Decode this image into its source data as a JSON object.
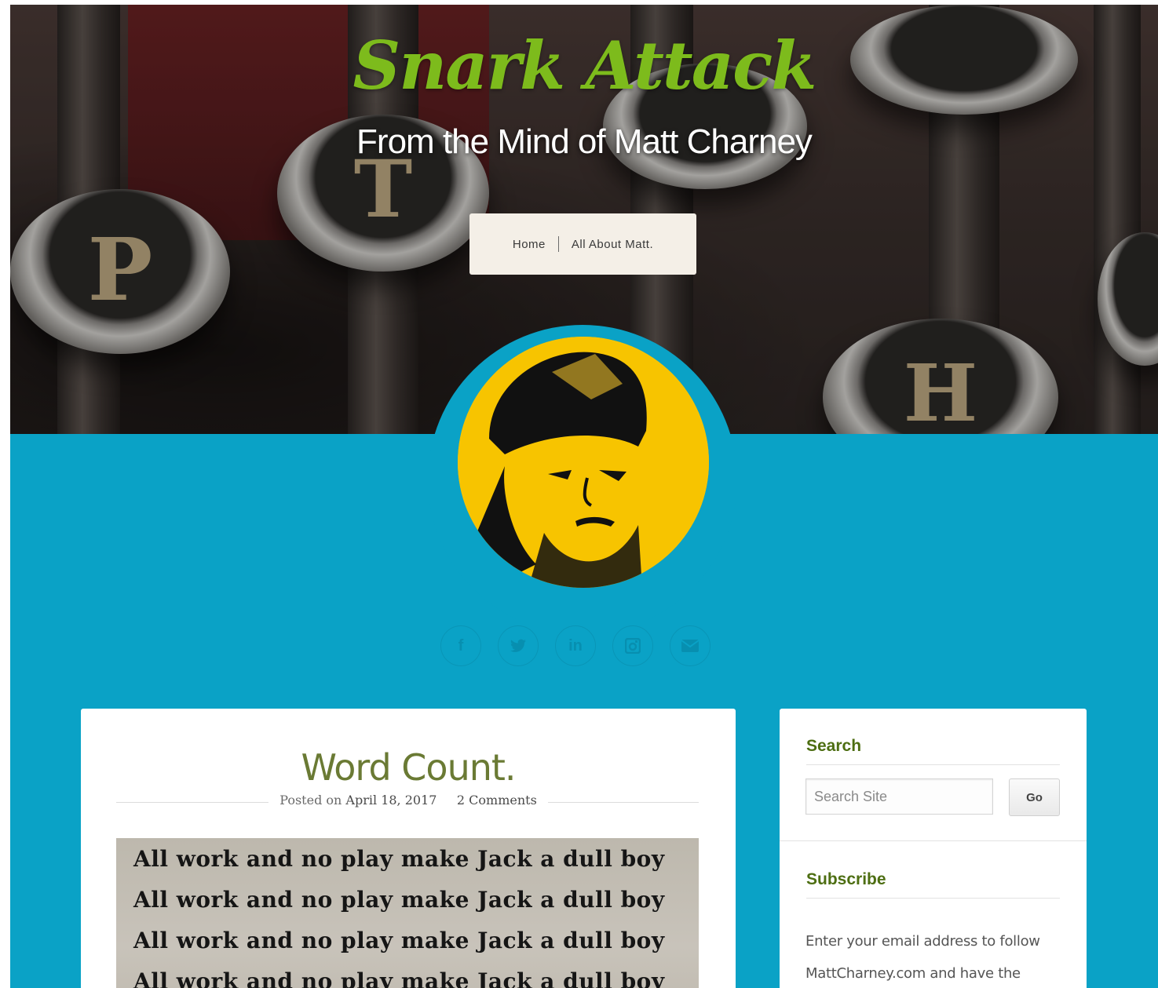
{
  "header": {
    "site_title": "Snark Attack",
    "tagline": "From the Mind of Matt Charney"
  },
  "nav": {
    "items": [
      {
        "label": "Home"
      },
      {
        "label": "All About Matt."
      }
    ]
  },
  "hero_keys": [
    "P",
    "T",
    "H"
  ],
  "social": [
    {
      "icon": "facebook-icon",
      "glyph": "f"
    },
    {
      "icon": "twitter-icon",
      "glyph": "🐦"
    },
    {
      "icon": "linkedin-icon",
      "glyph": "in"
    },
    {
      "icon": "instagram-icon",
      "glyph": "◙"
    },
    {
      "icon": "email-icon",
      "glyph": "✉"
    }
  ],
  "post": {
    "title": "Word Count.",
    "posted_on": "Posted on",
    "date": "April 18, 2017",
    "comments": "2 Comments",
    "image_lines": [
      "All work and no play make Jack a dull boy",
      "All work and no play make Jack a dull boy",
      "All work and no play make Jack a dull boy",
      "All work and no play make Jack a dull boy"
    ]
  },
  "sidebar": {
    "search": {
      "title": "Search",
      "placeholder": "Search Site",
      "button": "Go"
    },
    "subscribe": {
      "title": "Subscribe",
      "text": "Enter your email address to follow MattCharney.com and have the"
    }
  },
  "colors": {
    "teal": "#0aa2c6",
    "title_green": "#7dbb1c",
    "widget_green": "#4d6e12",
    "avatar_yellow": "#f7c400"
  }
}
